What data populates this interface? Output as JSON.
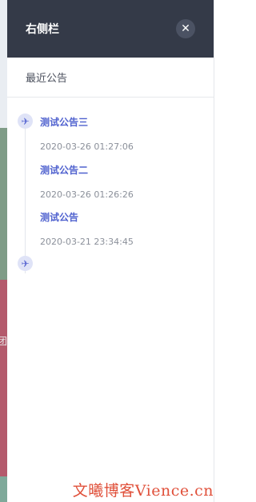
{
  "drawer": {
    "title": "右侧栏",
    "close_icon": "close-icon"
  },
  "section": {
    "title": "最近公告"
  },
  "timeline": {
    "icon": "airplane-icon",
    "items": [
      {
        "title": "测试公告三",
        "time": "2020-03-26 01:27:06"
      },
      {
        "title": "测试公告二",
        "time": "2020-03-26 01:26:26"
      },
      {
        "title": "测试公告",
        "time": "2020-03-21 23:34:45"
      }
    ]
  },
  "background": {
    "glyph": "团"
  },
  "watermark": "文曦博客Vience.cn",
  "colors": {
    "header_bg": "#343a48",
    "accent": "#5062cf",
    "dot_bg": "#dfe3f7"
  }
}
